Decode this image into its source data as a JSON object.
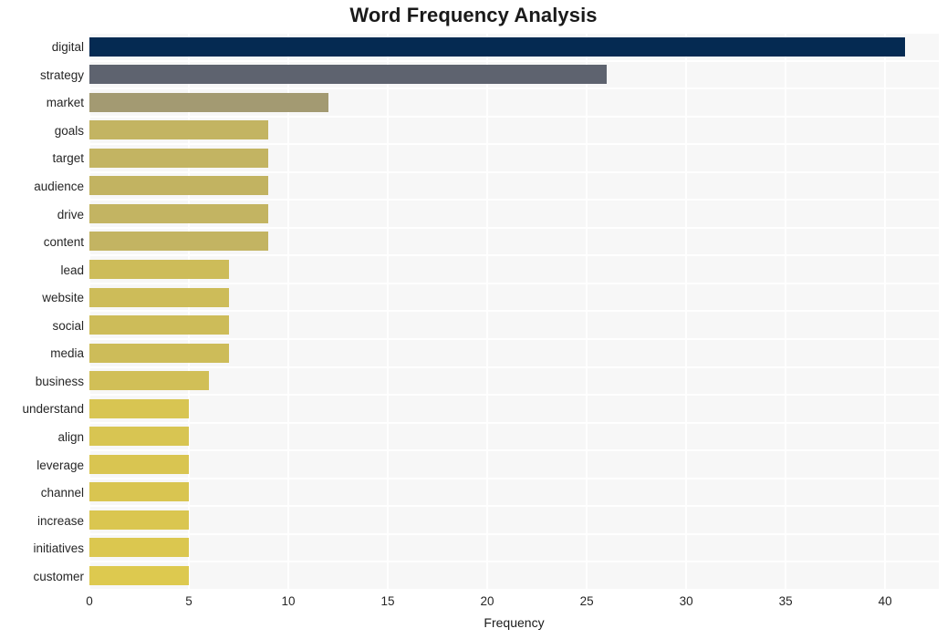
{
  "chart_data": {
    "type": "bar",
    "orientation": "horizontal",
    "title": "Word Frequency Analysis",
    "xlabel": "Frequency",
    "ylabel": "",
    "categories": [
      "digital",
      "strategy",
      "market",
      "goals",
      "target",
      "audience",
      "drive",
      "content",
      "lead",
      "website",
      "social",
      "media",
      "business",
      "understand",
      "align",
      "leverage",
      "channel",
      "increase",
      "initiatives",
      "customer"
    ],
    "values": [
      41,
      26,
      12,
      9,
      9,
      9,
      9,
      9,
      7,
      7,
      7,
      7,
      6,
      5,
      5,
      5,
      5,
      5,
      5,
      5
    ],
    "bar_colors": [
      "#052a52",
      "#5e636f",
      "#a39a72",
      "#c3b462",
      "#c3b462",
      "#c2b361",
      "#c3b462",
      "#c3b462",
      "#cdbc59",
      "#cdbc59",
      "#cdbc59",
      "#cdbc59",
      "#d1bf57",
      "#d8c552",
      "#d8c552",
      "#d9c551",
      "#d9c551",
      "#dac650",
      "#dbc74f",
      "#ddc94f"
    ],
    "xlim": [
      0,
      42.7
    ],
    "x_ticks": [
      0,
      5,
      10,
      15,
      20,
      25,
      30,
      35,
      40
    ],
    "x_tick_labels": [
      "0",
      "5",
      "10",
      "15",
      "20",
      "25",
      "30",
      "35",
      "40"
    ],
    "grid": {
      "vertical": true,
      "horizontal": true,
      "color": "#ffffff"
    },
    "legend": null,
    "plot_background": "#f7f7f7",
    "figure_background": "#ffffff"
  }
}
